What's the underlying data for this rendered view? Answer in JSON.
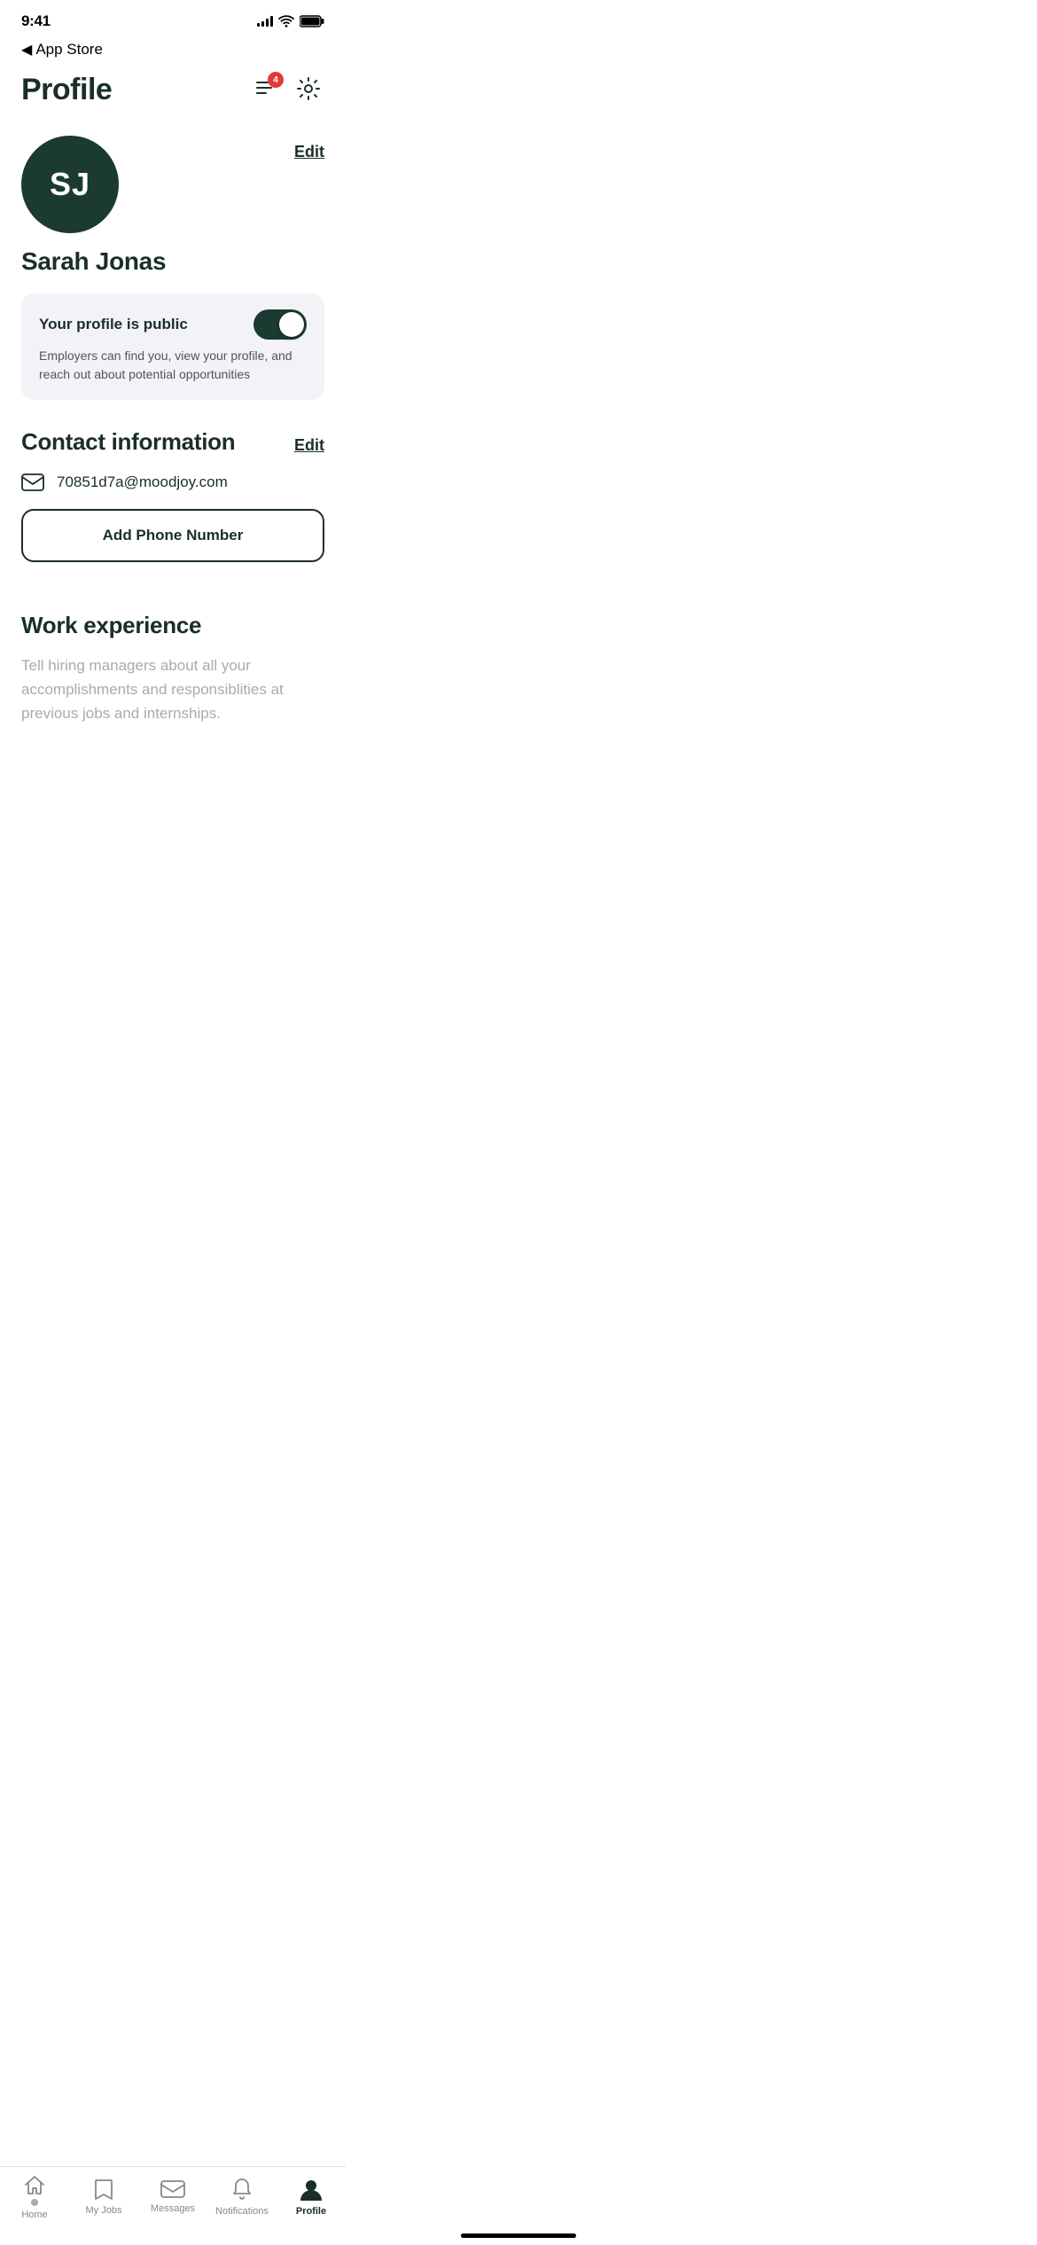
{
  "statusBar": {
    "time": "9:41",
    "back": "App Store"
  },
  "header": {
    "title": "Profile",
    "notificationCount": "4"
  },
  "profile": {
    "initials": "SJ",
    "name": "Sarah Jonas",
    "editLabel": "Edit",
    "publicCard": {
      "title": "Your profile is public",
      "description": "Employers can find you, view your profile, and reach out about potential opportunities",
      "toggleOn": true
    }
  },
  "contactInfo": {
    "sectionTitle": "Contact information",
    "editLabel": "Edit",
    "email": "70851d7a@moodjoy.com",
    "addPhoneLabel": "Add Phone Number"
  },
  "workExperience": {
    "sectionTitle": "Work experience",
    "description": "Tell hiring managers about all your accomplishments and responsiblities at previous jobs and internships."
  },
  "tabBar": {
    "items": [
      {
        "id": "home",
        "label": "Home",
        "active": false
      },
      {
        "id": "my-jobs",
        "label": "My Jobs",
        "active": false
      },
      {
        "id": "messages",
        "label": "Messages",
        "active": false
      },
      {
        "id": "notifications",
        "label": "Notifications",
        "active": false
      },
      {
        "id": "profile",
        "label": "Profile",
        "active": true
      }
    ]
  },
  "homeIndicator": ""
}
